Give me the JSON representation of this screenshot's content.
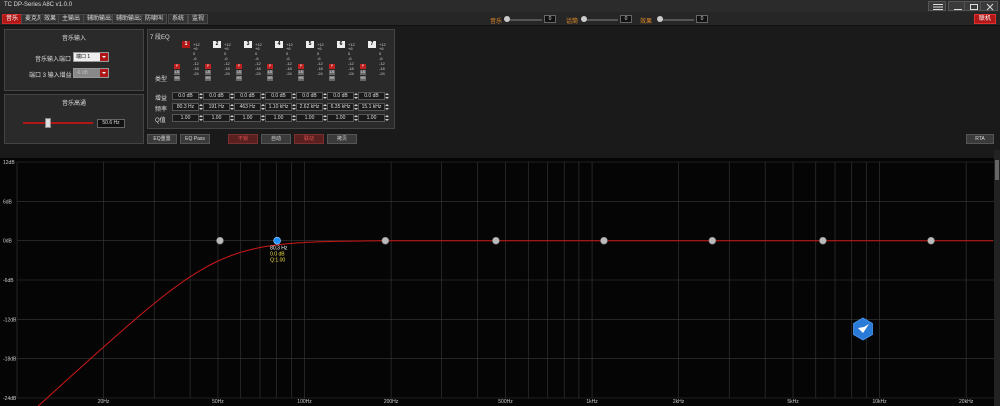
{
  "app": {
    "title": "TC DP-Series A8C  v1.0.0"
  },
  "menu": {
    "tabs": [
      {
        "label": "音乐",
        "active": true
      },
      {
        "label": "麦克风",
        "active": false
      },
      {
        "label": "效果",
        "active": false
      },
      {
        "label": "主输出",
        "active": false
      },
      {
        "label": "辅助输出1",
        "active": false
      },
      {
        "label": "辅助输出2",
        "active": false
      },
      {
        "label": "防啸叫",
        "active": false
      },
      {
        "label": "系统",
        "active": false
      },
      {
        "label": "监视",
        "active": false
      }
    ],
    "sliders": [
      {
        "label": "音乐",
        "value": "0"
      },
      {
        "label": "话筒",
        "value": "0"
      },
      {
        "label": "效果",
        "value": "0"
      }
    ],
    "online_label": "联机"
  },
  "music_input": {
    "title": "音乐输入",
    "port_label": "音乐输入端口",
    "port_value": "端口 1",
    "gain_label": "端口 3 输入增益",
    "gain_value": "-6 dB"
  },
  "music_hp": {
    "title": "音乐高通",
    "value": "50.6 Hz"
  },
  "eq": {
    "title": "7 段EQ",
    "scale": [
      "+12",
      "+6",
      "0",
      "-6",
      "-12",
      "-18",
      "-24"
    ],
    "row_labels": {
      "type": "类型",
      "gain": "增益",
      "freq": "频率",
      "q": "Q值"
    },
    "type_letters": [
      "P",
      "LS",
      "HS"
    ],
    "bands": [
      {
        "num": "1",
        "active": true,
        "gain": "0.0 dB",
        "freq": "80.3 Hz",
        "q": "1.00"
      },
      {
        "num": "2",
        "active": false,
        "gain": "0.0 dB",
        "freq": "191 Hz",
        "q": "1.00"
      },
      {
        "num": "3",
        "active": false,
        "gain": "0.0 dB",
        "freq": "463 Hz",
        "q": "1.00"
      },
      {
        "num": "4",
        "active": false,
        "gain": "0.0 dB",
        "freq": "1.10 kHz",
        "q": "1.00"
      },
      {
        "num": "5",
        "active": false,
        "gain": "0.0 dB",
        "freq": "2.62 kHz",
        "q": "1.00"
      },
      {
        "num": "6",
        "active": false,
        "gain": "0.0 dB",
        "freq": "6.35 kHz",
        "q": "1.00"
      },
      {
        "num": "7",
        "active": false,
        "gain": "0.0 dB",
        "freq": "15.1 kHz",
        "q": "1.00"
      }
    ]
  },
  "toolbar": {
    "eq_reset": "EQ重置",
    "eq_pass": "EQ Pass",
    "unlock": "不锁",
    "auto_eq": "自动",
    "link": "联动",
    "copy": "拷贝",
    "rta": "RTA"
  },
  "graph": {
    "y_ticks": [
      "12dB",
      "6dB",
      "0dB",
      "-6dB",
      "-12dB",
      "-18dB",
      "-24dB"
    ],
    "x_ticks": [
      "20Hz",
      "50Hz",
      "100Hz",
      "200Hz",
      "500Hz",
      "1kHz",
      "2kHz",
      "5kHz",
      "10kHz",
      "20kHz"
    ],
    "active_point": {
      "freq": "80.3 Hz",
      "gain": "0.0 dB",
      "q": "Q:1.00",
      "band": "1"
    },
    "colors": {
      "curve": "#d01818",
      "grid": "#3a3a3a",
      "active": "#1e90ff"
    }
  }
}
